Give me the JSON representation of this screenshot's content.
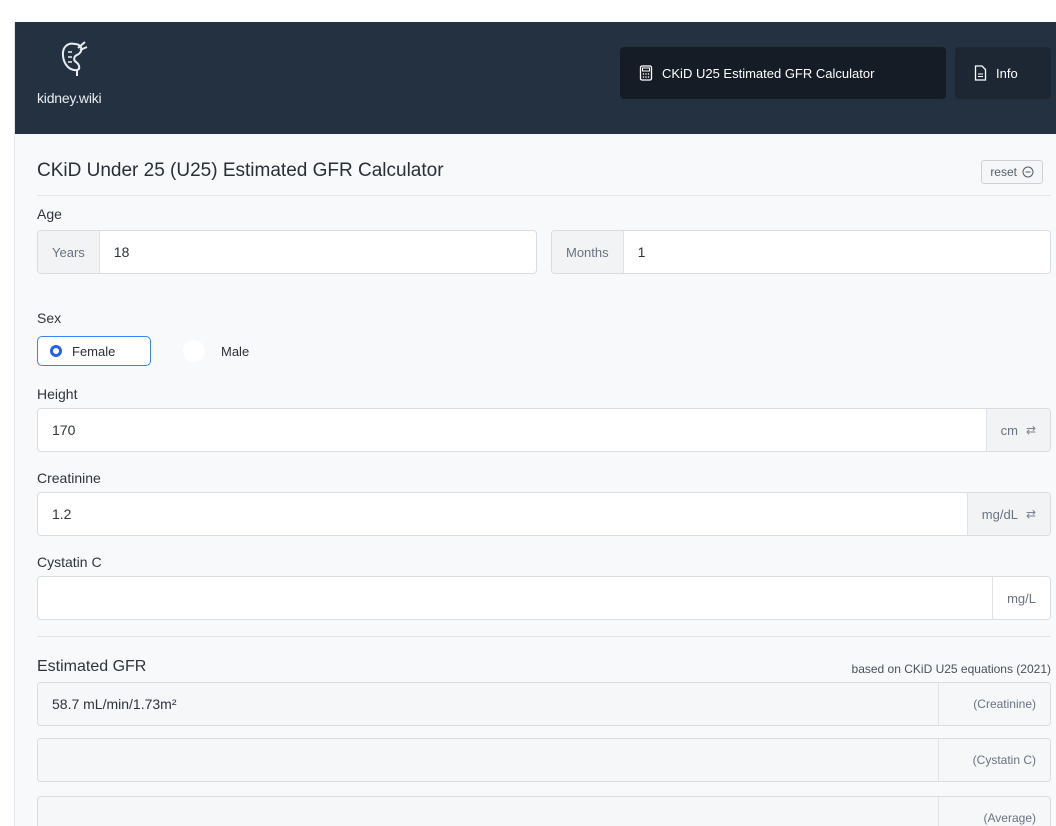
{
  "header": {
    "logo_text": "kidney.wiki",
    "nav_calculator": "CKiD U25 Estimated GFR Calculator",
    "nav_info": "Info"
  },
  "page": {
    "title": "CKiD Under 25 (U25) Estimated GFR Calculator",
    "reset_label": "reset"
  },
  "age": {
    "label": "Age",
    "years_addon": "Years",
    "years_value": "18",
    "months_addon": "Months",
    "months_value": "1"
  },
  "sex": {
    "label": "Sex",
    "options": [
      "Female",
      "Male"
    ],
    "selected": "Female"
  },
  "height": {
    "label": "Height",
    "value": "170",
    "unit": "cm"
  },
  "creatinine": {
    "label": "Creatinine",
    "value": "1.2",
    "unit": "mg/dL"
  },
  "cystatin": {
    "label": "Cystatin C",
    "value": "",
    "unit": "mg/L"
  },
  "results": {
    "title": "Estimated GFR",
    "note": "based on CKiD U25 equations (2021)",
    "rows": [
      {
        "value": "58.7 mL/min/1.73m²",
        "tag": "(Creatinine)"
      },
      {
        "value": "",
        "tag": "(Cystatin C)"
      },
      {
        "value": "",
        "tag": "(Average)"
      }
    ]
  }
}
